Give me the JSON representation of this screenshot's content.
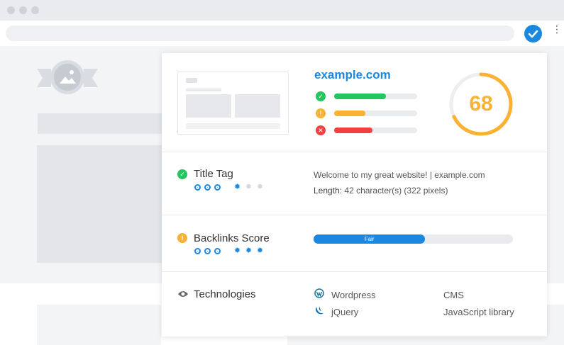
{
  "browser": {
    "toolbar": {
      "menu_glyph": "⋮"
    }
  },
  "panel": {
    "header": {
      "domain": "example.com",
      "score": "68",
      "bars": [
        {
          "status": "pass",
          "color": "#22c55e",
          "fill": 0.62
        },
        {
          "status": "warning",
          "color": "#f9b233",
          "fill": 0.38
        },
        {
          "status": "error",
          "color": "#f04040",
          "fill": 0.46
        }
      ],
      "score_fraction": 0.68,
      "score_color": "#f9b233"
    },
    "title_tag": {
      "label": "Title Tag",
      "value": "Welcome to my great website! | example.com",
      "length_label": "Length:",
      "length_value": "42 character(s) (322 pixels)",
      "importance_filled": 3,
      "difficulty_filled": 1
    },
    "backlinks": {
      "label": "Backlinks Score",
      "rating": "Fair",
      "fill": 0.56,
      "importance_filled": 3,
      "difficulty_filled": 3
    },
    "technologies": {
      "label": "Technologies",
      "items": [
        {
          "name": "Wordpress",
          "category": "CMS",
          "icon": "wordpress-icon"
        },
        {
          "name": "jQuery",
          "category": "JavaScript library",
          "icon": "jquery-icon"
        }
      ]
    }
  },
  "colors": {
    "accent": "#1a88e0",
    "pass": "#22c55e",
    "warning": "#f9b233",
    "error": "#f04040"
  }
}
